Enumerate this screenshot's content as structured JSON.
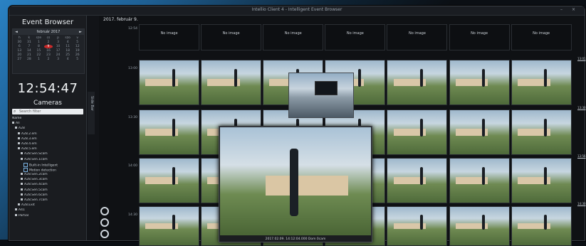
{
  "window": {
    "title": "Intellio Client 4 - Intelligent Event Browser"
  },
  "sidebar": {
    "title": "Event Browser",
    "calendar": {
      "month": "február 2017",
      "prev": "◄",
      "next": "►",
      "weekdays": [
        "h",
        "k",
        "sze",
        "cs",
        "p",
        "szo",
        "v"
      ],
      "days": [
        "30",
        "31",
        "1",
        "2",
        "3",
        "4",
        "5",
        "6",
        "7",
        "8",
        "9",
        "10",
        "11",
        "12",
        "13",
        "14",
        "15",
        "16",
        "17",
        "18",
        "19",
        "20",
        "21",
        "22",
        "23",
        "24",
        "25",
        "26",
        "27",
        "28",
        "1",
        "2",
        "3",
        "4",
        "5"
      ],
      "selected_day": "9"
    },
    "clock": "12:54:47",
    "cameras_title": "Cameras",
    "search_placeholder": "Search filter",
    "tree_header": "Name",
    "tree": [
      "All",
      "A28",
      "A28.2.em",
      "A28.3.em",
      "A28.4.em",
      "A28.5.em",
      "A28.Sen.Scam",
      "A28.Sen.1cam",
      "Built-in Intelligent",
      "Motion detection",
      "A28.Sen.2cam",
      "A28.Sen.3cam",
      "A28.Sen.4cam",
      "A28.Sen.5cam",
      "A28.Sen.6cam",
      "A28.Sen.7cam",
      "A28.Exit",
      "A41",
      "Partial"
    ],
    "tab_label": "Side Bar"
  },
  "main": {
    "date_label": "2017. február 9.",
    "times_left": [
      "12:54",
      "13:00",
      "13:30",
      "14:00",
      "14:30"
    ],
    "times_right": [
      "13:01",
      "13:30",
      "13:56",
      "14:30"
    ],
    "no_image_label": "No image",
    "popup_caption": "2017.02.09. 14:12:04.000 Dom 0cam"
  }
}
